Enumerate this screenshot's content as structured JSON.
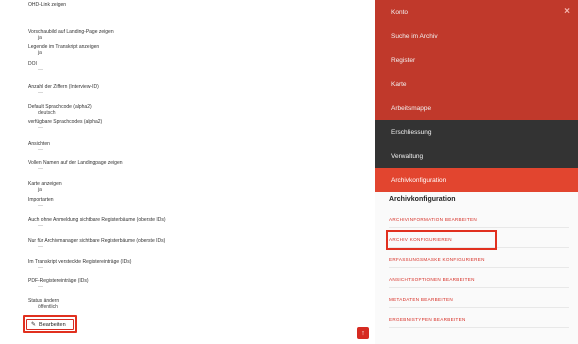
{
  "settings": [
    {
      "label": "OHD-Link zeigen",
      "value": ""
    },
    {
      "label": "Vorschaubild auf Landing-Page zeigen",
      "value": "ja"
    },
    {
      "label": "Legende im Transkript anzeigen",
      "value": "ja"
    },
    {
      "label": "DOI",
      "value": "—"
    },
    {
      "label": "Anzahl der Ziffern (Interview-ID)",
      "value": "—"
    },
    {
      "label": "Default Sprachcode (alpha2)",
      "value": "deutsch"
    },
    {
      "label": "verfügbare Sprachcodes (alpha2)",
      "value": "—"
    },
    {
      "label": "Ansichten",
      "value": "—"
    },
    {
      "label": "Vollen Namen auf der Landingpage zeigen",
      "value": "—"
    },
    {
      "label": "Karte anzeigen",
      "value": "ja"
    },
    {
      "label": "Importarten",
      "value": "—"
    },
    {
      "label": "Auch ohne Anmeldung sichtbare Registerbäume (oberste IDs)",
      "value": "—"
    },
    {
      "label": "Nur für Archivmanager sichtbare Registerbäume (oberste IDs)",
      "value": "—"
    },
    {
      "label": "Im Transkript versteckte Registereinträge (IDs)",
      "value": "—"
    },
    {
      "label": "PDF-Registereinträge (IDs)",
      "value": "—"
    },
    {
      "label": "Status ändern",
      "value": "öffentlich"
    }
  ],
  "edit_button": {
    "label": "Bearbeiten",
    "icon": "pencil-icon"
  },
  "scroll_top": {
    "icon": "arrow-up-icon",
    "glyph": "↑"
  },
  "sidebar": {
    "close_glyph": "×",
    "nav": [
      {
        "label": "Konto",
        "style": "red"
      },
      {
        "label": "Suche im Archiv",
        "style": "red"
      },
      {
        "label": "Register",
        "style": "red"
      },
      {
        "label": "Karte",
        "style": "red"
      },
      {
        "label": "Arbeitsmappe",
        "style": "red"
      },
      {
        "label": "Erschliessung",
        "style": "dark"
      },
      {
        "label": "Verwaltung",
        "style": "dark"
      },
      {
        "label": "Archivkonfiguration",
        "style": "active"
      }
    ],
    "submenu_title": "Archivkonfiguration",
    "submenu": [
      "ARCHIVINFORMATION BEARBEITEN",
      "ARCHIV KONFIGURIEREN",
      "ERFASSUNGSMASKE KONFIGURIEREN",
      "ANSICHTSOPTIONEN BEARBEITEN",
      "METADATEN BEARBEITEN",
      "ERGEBNISTYPEN BEARBEITEN"
    ]
  },
  "colors": {
    "accent": "#e2452f",
    "brand_red": "#c0392b",
    "dark": "#333333",
    "highlight": "#e1301f"
  }
}
